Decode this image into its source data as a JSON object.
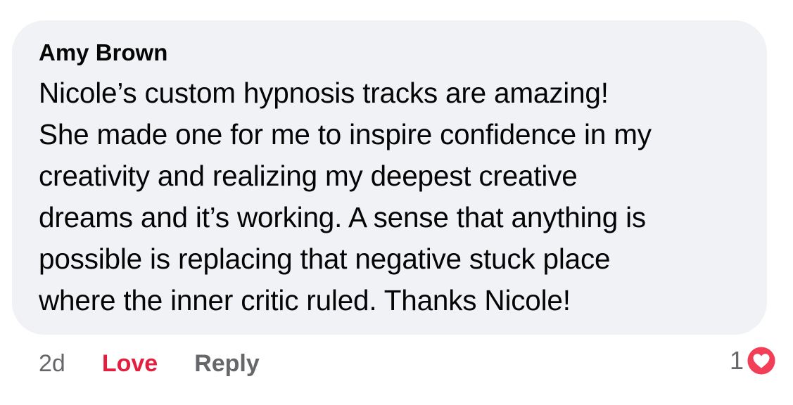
{
  "comment": {
    "author": "Amy Brown",
    "text_lines": [
      "Nicole’s custom hypnosis tracks are amazing!",
      "She made one for me to inspire confidence in my",
      "creativity and realizing my deepest creative",
      "dreams and it’s working. A sense that anything is",
      "possible is replacing that negative stuck place",
      "where the inner critic ruled. Thanks Nicole!"
    ]
  },
  "actions": {
    "timestamp": "2d",
    "love_label": "Love",
    "reply_label": "Reply"
  },
  "reactions": {
    "count": "1",
    "icon": "heart-love-icon"
  },
  "colors": {
    "bubble_background": "#f0f2f5",
    "text": "#050505",
    "muted": "#65676b",
    "love_accent": "#e41e3f",
    "reaction_red": "#f33e58"
  }
}
